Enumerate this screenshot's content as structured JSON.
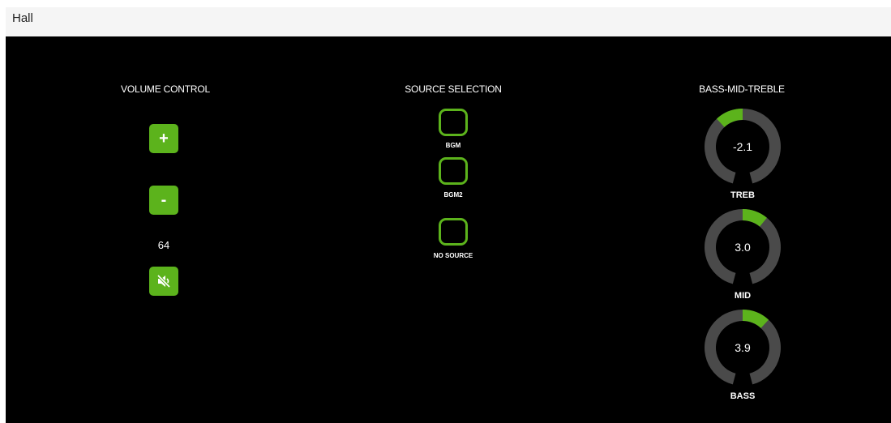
{
  "window": {
    "title": "Hall"
  },
  "volume": {
    "title": "VOLUME CONTROL",
    "up_label": "+",
    "down_label": "-",
    "level": "64",
    "mute_icon": "mute-speaker-icon"
  },
  "source": {
    "title": "SOURCE SELECTION",
    "options": [
      {
        "label": "BGM"
      },
      {
        "label": "BGM2"
      },
      {
        "label": "NO SOURCE"
      }
    ]
  },
  "tone": {
    "title": "BASS-MID-TREBLE",
    "controls": [
      {
        "label": "TREB",
        "value": "-2.1",
        "fill_fraction": -0.13
      },
      {
        "label": "MID",
        "value": "3.0",
        "fill_fraction": 0.12
      },
      {
        "label": "BASS",
        "value": "3.9",
        "fill_fraction": 0.13
      }
    ]
  },
  "colors": {
    "accent": "#5cb31c",
    "track": "#4a4a4a",
    "background": "#000000"
  }
}
